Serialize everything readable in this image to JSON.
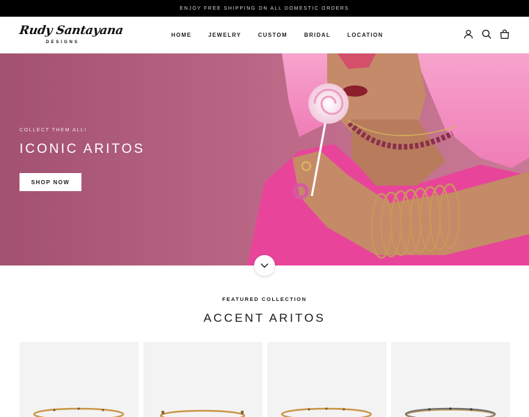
{
  "announcement": {
    "text": "ENJOY FREE SHIPPING ON ALL DOMESTIC ORDERS"
  },
  "header": {
    "logo_script": "Rudy Santayana",
    "logo_sub": "DESIGNS",
    "nav": [
      {
        "label": "HOME"
      },
      {
        "label": "JEWELRY"
      },
      {
        "label": "CUSTOM"
      },
      {
        "label": "BRIDAL"
      },
      {
        "label": "LOCATION"
      }
    ],
    "icons": [
      "account-icon",
      "search-icon",
      "cart-icon"
    ]
  },
  "hero": {
    "kicker": "COLLECT THEM ALL!",
    "title": "ICONIC ARITOS",
    "button": "SHOP NOW",
    "scroll_icon": "chevron-down-icon"
  },
  "featured": {
    "kicker": "FEATURED COLLECTION",
    "title": "ACCENT ARITOS",
    "products": [
      {
        "image": "gold-bangle-with-accents"
      },
      {
        "image": "gold-bangle-with-accents"
      },
      {
        "image": "gold-bangle-with-accents"
      },
      {
        "image": "two-tone-bangle-with-accents"
      }
    ]
  },
  "colors": {
    "announcement_bg": "#000000",
    "hero_bg": "#b4607d",
    "card_bg": "#f3f3f3",
    "text": "#1c1b1b"
  }
}
